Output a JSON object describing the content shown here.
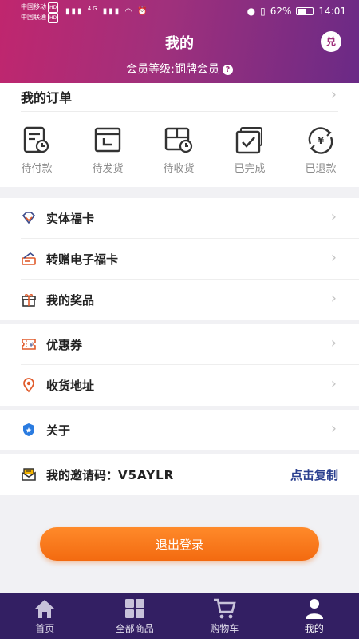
{
  "status_bar": {
    "carrier1": "中国移动",
    "carrier2": "中国联通",
    "hd": "HD",
    "signal": "4G",
    "battery_text": "62%",
    "battery_level": 0.62,
    "time": "14:01"
  },
  "header": {
    "title": "我的",
    "redeem": "兑",
    "member_level": "会员等级:铜牌会员",
    "help": "?"
  },
  "orders": {
    "title": "我的订单",
    "items": [
      {
        "label": "待付款",
        "icon": "pending-payment-icon"
      },
      {
        "label": "待发货",
        "icon": "pending-shipment-icon"
      },
      {
        "label": "待收货",
        "icon": "pending-receipt-icon"
      },
      {
        "label": "已完成",
        "icon": "completed-icon"
      },
      {
        "label": "已退款",
        "icon": "refunded-icon"
      }
    ]
  },
  "menu": {
    "physical_card": "实体福卡",
    "gift_ecard": "转赠电子福卡",
    "my_prizes": "我的奖品",
    "coupons": "优惠券",
    "address": "收货地址",
    "about": "关于"
  },
  "invite": {
    "label": "我的邀请码：",
    "code": "V5AYLR",
    "copy": "点击复制"
  },
  "logout": "退出登录",
  "tabs": [
    {
      "label": "首页",
      "icon": "home-icon"
    },
    {
      "label": "全部商品",
      "icon": "grid-icon"
    },
    {
      "label": "购物车",
      "icon": "cart-icon"
    },
    {
      "label": "我的",
      "icon": "user-icon"
    }
  ],
  "colors": {
    "header_start": "#c0266e",
    "header_end": "#6a2a86",
    "accent_orange": "#f36a10",
    "tabbar": "#331f63",
    "copy_link": "#2a3f8f"
  }
}
